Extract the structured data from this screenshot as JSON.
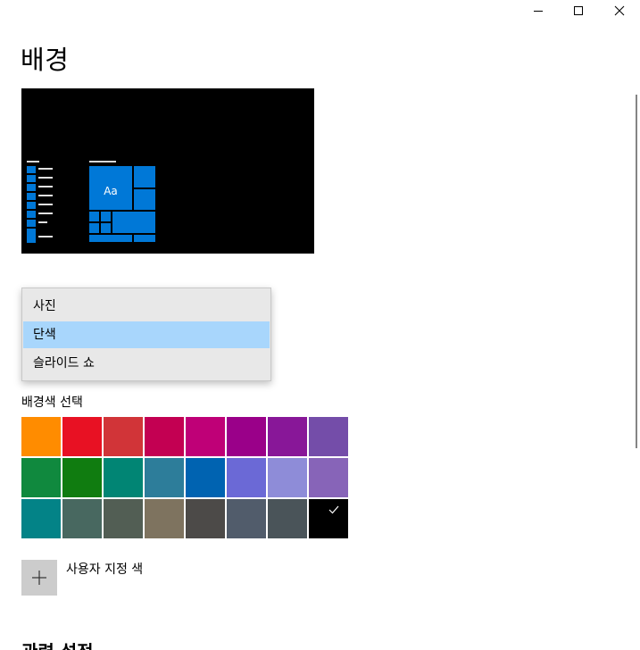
{
  "page": {
    "title": "배경"
  },
  "window_controls": {
    "minimize_icon": "minimize-icon",
    "maximize_icon": "maximize-icon",
    "close_icon": "close-icon"
  },
  "preview": {
    "tile_label": "Aa",
    "accent_color": "#0078d7"
  },
  "background_dropdown": {
    "options": [
      "사진",
      "단색",
      "슬라이드 쇼"
    ],
    "selected": "단색",
    "highlight_color": "#a8d6fc"
  },
  "color_picker": {
    "label": "배경색 선택",
    "selected_color": "#000000",
    "rows": [
      [
        "#ff8c00",
        "#e81123",
        "#d13438",
        "#c30052",
        "#bf0077",
        "#9a0089",
        "#881798",
        "#744da9"
      ],
      [
        "#10893e",
        "#107c10",
        "#018574",
        "#2d7d9a",
        "#0063b1",
        "#6b69d6",
        "#8e8cd8",
        "#8764b8"
      ],
      [
        "#038387",
        "#486860",
        "#525e54",
        "#7e735f",
        "#4c4a48",
        "#515c6b",
        "#4a5459",
        "#000000"
      ]
    ]
  },
  "custom_color": {
    "label": "사용자 지정 색",
    "icon": "plus-icon"
  },
  "related_settings": {
    "title": "관련 설정"
  }
}
